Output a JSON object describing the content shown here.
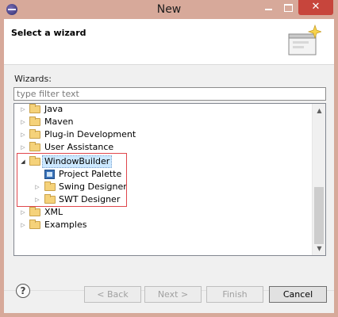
{
  "window": {
    "title": "New",
    "close_glyph": "✕"
  },
  "header": {
    "title": "Select a wizard"
  },
  "wizards": {
    "label": "Wizards:",
    "filter_placeholder": "type filter text",
    "tree": [
      {
        "label": "Java",
        "icon": "folder-icon",
        "expanded": false
      },
      {
        "label": "Maven",
        "icon": "folder-icon",
        "expanded": false
      },
      {
        "label": "Plug-in Development",
        "icon": "folder-icon",
        "expanded": false
      },
      {
        "label": "User Assistance",
        "icon": "folder-icon",
        "expanded": false
      },
      {
        "label": "WindowBuilder",
        "icon": "folder-icon",
        "expanded": true,
        "selected": true
      },
      {
        "label": "Project Palette",
        "icon": "palette-icon",
        "leaf": true
      },
      {
        "label": "Swing Designer",
        "icon": "folder-icon",
        "expanded": false
      },
      {
        "label": "SWT Designer",
        "icon": "folder-icon",
        "expanded": false
      },
      {
        "label": "XML",
        "icon": "folder-icon",
        "expanded": false
      },
      {
        "label": "Examples",
        "icon": "folder-icon",
        "expanded": false
      }
    ]
  },
  "buttons": {
    "help": "?",
    "back": "< Back",
    "next": "Next >",
    "finish": "Finish",
    "cancel": "Cancel"
  },
  "colors": {
    "titlebar": "#d7a99a",
    "close_button": "#c7453c",
    "highlight": "#e0474c",
    "selection": "#cce8ff"
  }
}
